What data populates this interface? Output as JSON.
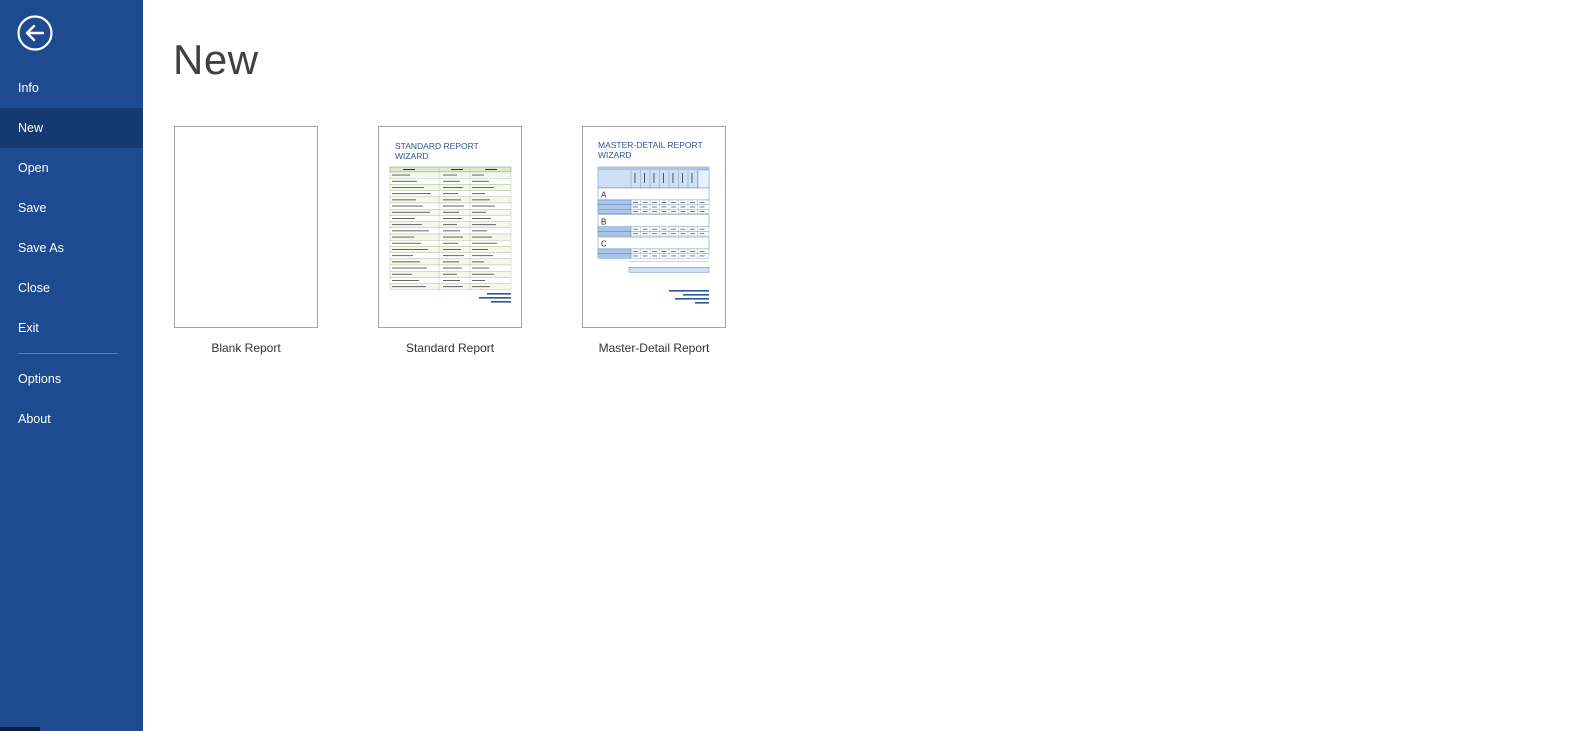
{
  "sidebar": {
    "items": [
      {
        "id": "info",
        "label": "Info",
        "active": false
      },
      {
        "id": "new",
        "label": "New",
        "active": true
      },
      {
        "id": "open",
        "label": "Open",
        "active": false
      },
      {
        "id": "save",
        "label": "Save",
        "active": false
      },
      {
        "id": "save-as",
        "label": "Save As",
        "active": false
      },
      {
        "id": "close",
        "label": "Close",
        "active": false
      },
      {
        "id": "exit",
        "label": "Exit",
        "active": false
      }
    ],
    "secondary_items": [
      {
        "id": "options",
        "label": "Options"
      },
      {
        "id": "about",
        "label": "About"
      }
    ]
  },
  "main": {
    "title": "New",
    "templates": [
      {
        "id": "blank",
        "label": "Blank Report"
      },
      {
        "id": "standard",
        "label": "Standard Report",
        "thumb_title_1": "STANDARD REPORT",
        "thumb_title_2": "WIZARD"
      },
      {
        "id": "master-detail",
        "label": "Master-Detail Report",
        "thumb_title_1": "MASTER-DETAIL REPORT",
        "thumb_title_2": "WIZARD",
        "groups": [
          "A",
          "B",
          "C"
        ]
      }
    ]
  },
  "colors": {
    "sidebar_bg": "#1e4a92",
    "sidebar_active": "#163a6f",
    "thumb_title": "#2e5597"
  },
  "icons": {
    "back": "arrow-left-circle-icon"
  }
}
